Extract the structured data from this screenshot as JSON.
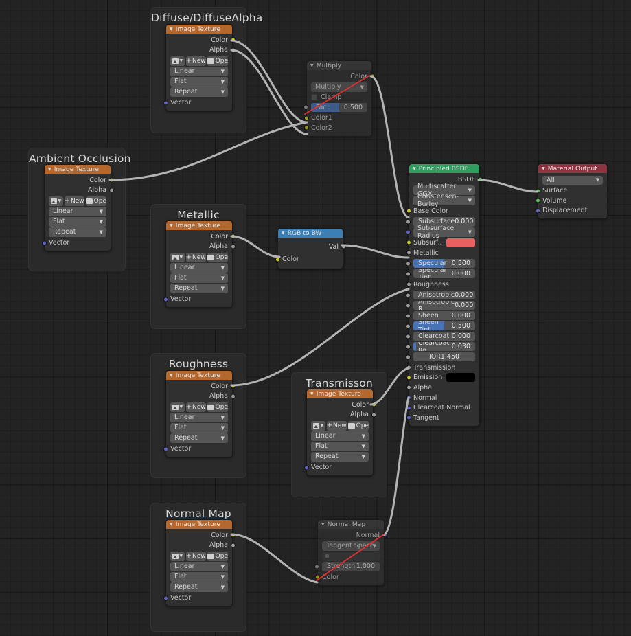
{
  "editor": {
    "name": "Blender Shader Node Editor",
    "background": "#232323",
    "wire_color": "#b3b3b3",
    "drag_wire_color": "#e03030"
  },
  "palette": {
    "header_texture": "#b5682e",
    "header_bsdf": "#2f9e5e",
    "header_output": "#8e3440",
    "header_converter": "#3b7fb5",
    "socket_color": "#c7c72b",
    "socket_float": "#9b9b9b",
    "socket_vector": "#6363c7",
    "socket_shader": "#4ec44e",
    "slider_fill": "#4772b3",
    "subsurface_swatch": "#e8605f",
    "emission_swatch": "#000000"
  },
  "common": {
    "image_texture_title": "Image Texture",
    "color_label": "Color",
    "alpha_label": "Alpha",
    "vector_label": "Vector",
    "new_label": "New",
    "open_label": "Ope",
    "interpolation": "Linear",
    "projection": "Flat",
    "extension": "Repeat"
  },
  "frames": [
    {
      "label": "Diffuse/DiffuseAlpha"
    },
    {
      "label": "Ambient Occlusion"
    },
    {
      "label": "Metallic"
    },
    {
      "label": "Roughness"
    },
    {
      "label": "Transmisson"
    },
    {
      "label": "Normal Map"
    }
  ],
  "nodes": {
    "multiply": {
      "title": "Multiply",
      "output_color": "Color",
      "blend_mode": "Multiply",
      "clamp_label": "Clamp",
      "fac_label": "Fac",
      "fac_value": "0.500",
      "color1_label": "Color1",
      "color2_label": "Color2"
    },
    "rgb_to_bw": {
      "title": "RGB to BW",
      "output_val": "Val",
      "input_color": "Color"
    },
    "normal_map": {
      "title": "Normal Map",
      "output_normal": "Normal",
      "space": "Tangent Space",
      "uv_map": "",
      "strength_label": "Strength",
      "strength_value": "1.000",
      "color_label": "Color"
    },
    "material_output": {
      "title": "Material Output",
      "target": "All",
      "surface": "Surface",
      "volume": "Volume",
      "displacement": "Displacement"
    },
    "principled": {
      "title": "Principled BSDF",
      "output": "BSDF",
      "distribution": "Multiscatter GGX",
      "subsurface_method": "Christensen-Burley",
      "inputs": [
        {
          "label": "Base Color",
          "socket": "color",
          "widget": "none"
        },
        {
          "label": "Subsurface",
          "socket": "float",
          "widget": "slider",
          "value": "0.000",
          "fill": 0
        },
        {
          "label": "Subsurface Radius",
          "socket": "vector",
          "widget": "dropdown"
        },
        {
          "label": "Subsurf..",
          "socket": "color",
          "widget": "swatch",
          "swatch": "#e8605f"
        },
        {
          "label": "Metallic",
          "socket": "float",
          "widget": "none"
        },
        {
          "label": "Specular",
          "socket": "float",
          "widget": "slider",
          "value": "0.500",
          "fill": 50
        },
        {
          "label": "Specular Tint",
          "socket": "float",
          "widget": "slider",
          "value": "0.000",
          "fill": 0
        },
        {
          "label": "Roughness",
          "socket": "float",
          "widget": "none"
        },
        {
          "label": "Anisotropic",
          "socket": "float",
          "widget": "slider",
          "value": "0.000",
          "fill": 0
        },
        {
          "label": "Anisotropic R",
          "socket": "float",
          "widget": "slider",
          "value": "0.000",
          "fill": 0
        },
        {
          "label": "Sheen",
          "socket": "float",
          "widget": "slider",
          "value": "0.000",
          "fill": 0
        },
        {
          "label": "Sheen Tint",
          "socket": "float",
          "widget": "slider",
          "value": "0.500",
          "fill": 50
        },
        {
          "label": "Clearcoat",
          "socket": "float",
          "widget": "slider",
          "value": "0.000",
          "fill": 0
        },
        {
          "label": "Clearcoat Ro",
          "socket": "float",
          "widget": "slider",
          "value": "0.030",
          "fill": 4
        },
        {
          "label": "IOR",
          "socket": "float",
          "widget": "slider",
          "value": "1.450",
          "fill": 0,
          "center": true
        },
        {
          "label": "Transmission",
          "socket": "float",
          "widget": "none"
        },
        {
          "label": "Emission",
          "socket": "color",
          "widget": "swatch",
          "swatch": "#000000"
        },
        {
          "label": "Alpha",
          "socket": "float",
          "widget": "none"
        },
        {
          "label": "Normal",
          "socket": "vector",
          "widget": "none"
        },
        {
          "label": "Clearcoat Normal",
          "socket": "vector",
          "widget": "none"
        },
        {
          "label": "Tangent",
          "socket": "vector",
          "widget": "none"
        }
      ]
    }
  }
}
